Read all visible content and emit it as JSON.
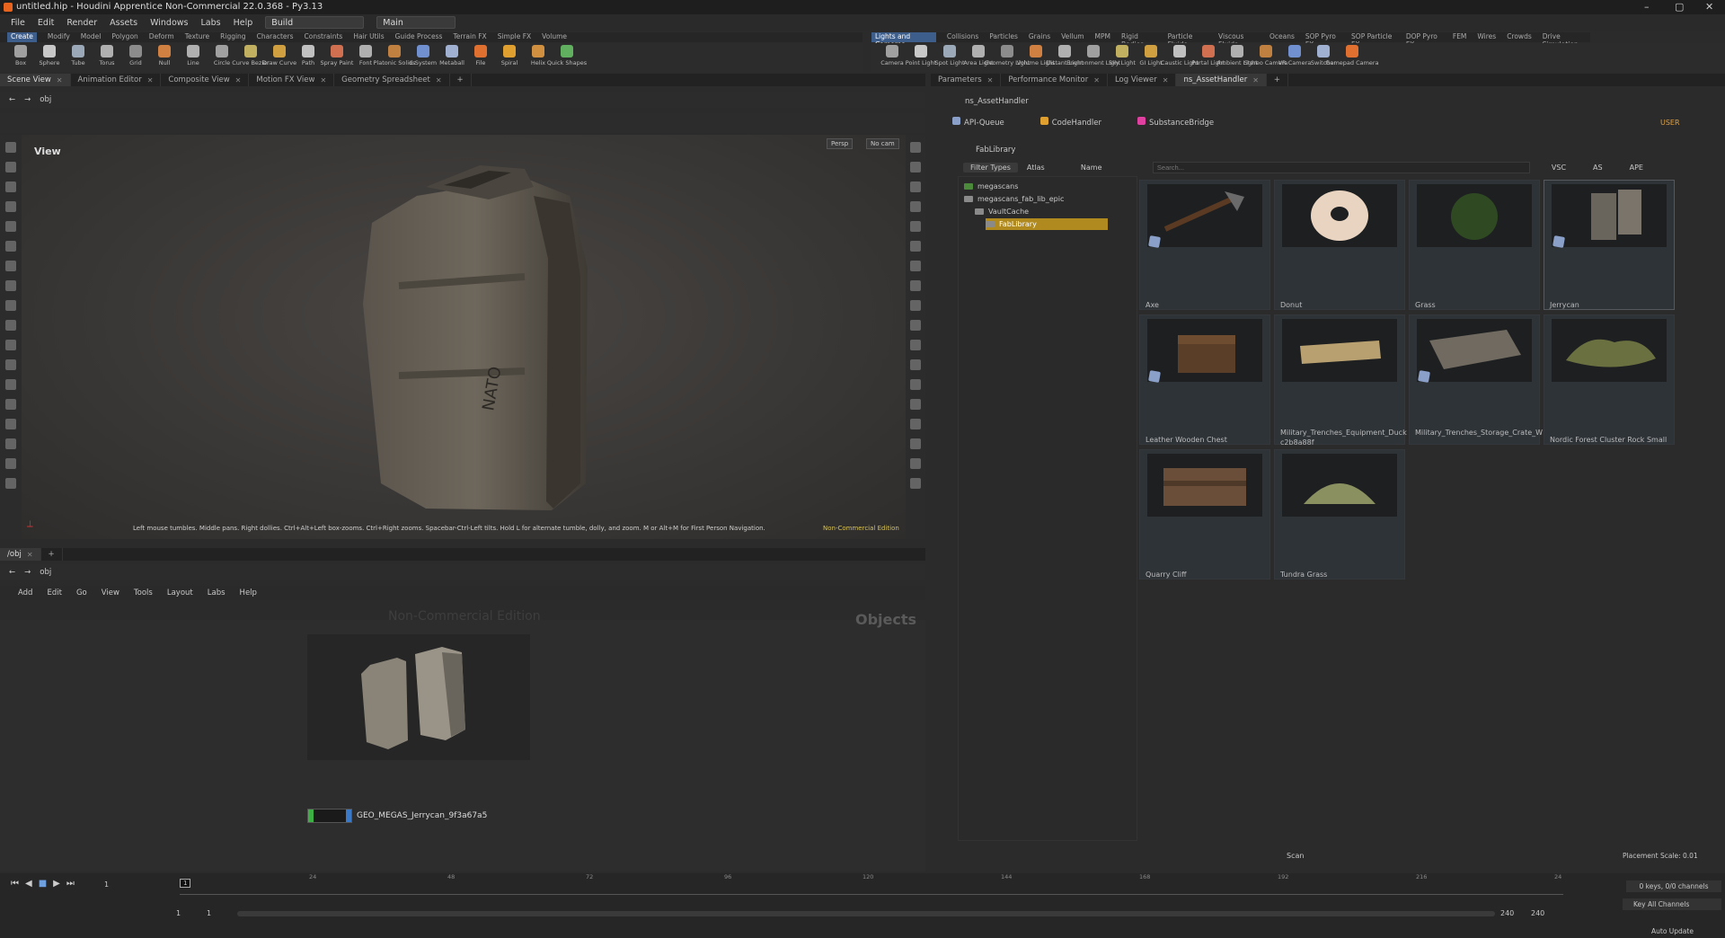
{
  "window": {
    "title": "untitled.hip - Houdini Apprentice Non-Commercial 22.0.368 - Py3.13"
  },
  "menu": {
    "items": [
      "File",
      "Edit",
      "Render",
      "Assets",
      "Windows",
      "Labs",
      "Help"
    ],
    "desktop": "Build",
    "context": "Main"
  },
  "shelf": {
    "tabs_left": [
      "Create",
      "Modify",
      "Model",
      "Polygon",
      "Deform",
      "Texture",
      "Rigging",
      "Characters",
      "Constraints",
      "Hair Utils",
      "Guide Process",
      "Terrain FX",
      "Simple FX",
      "Volume"
    ],
    "tabs_right": [
      "Lights and Cameras",
      "Collisions",
      "Particles",
      "Grains",
      "Vellum",
      "MPM",
      "Rigid Bodies",
      "Particle Fluids",
      "Viscous Fluids",
      "Oceans",
      "SOP Pyro FX",
      "SOP Particle FX",
      "DOP Pyro FX",
      "FEM",
      "Wires",
      "Crowds",
      "Drive Simulation"
    ],
    "tools_left": [
      "Box",
      "Sphere",
      "Tube",
      "Torus",
      "Grid",
      "Null",
      "Line",
      "Circle",
      "Curve Bezier",
      "Draw Curve",
      "Path",
      "Spray Paint",
      "Font",
      "Platonic Solids",
      "L-System",
      "Metaball",
      "File",
      "Spiral",
      "Helix",
      "Quick Shapes"
    ],
    "tools_right": [
      "Camera",
      "Point Light",
      "Spot Light",
      "Area Light",
      "Geometry Light",
      "Volume Light",
      "Distant Light",
      "Environment Light",
      "Sky Light",
      "GI Light",
      "Caustic Light",
      "Portal Light",
      "Ambient Light",
      "Stereo Camera",
      "VR Camera",
      "Switcher",
      "Gamepad Camera"
    ]
  },
  "left_tabs": [
    "Scene View",
    "Animation Editor",
    "Composite View",
    "Motion FX View",
    "Geometry Spreadsheet"
  ],
  "viewport": {
    "path": "obj",
    "label": "View",
    "persp": "Persp",
    "cam": "No cam",
    "hint": "Left mouse tumbles. Middle pans. Right dollies. Ctrl+Alt+Left box-zooms. Ctrl+Right zooms. Spacebar-Ctrl-Left tilts. Hold L for alternate tumble, dolly, and zoom. M or Alt+M for First Person Navigation.",
    "edition": "Non-Commercial Edition",
    "can_text": "NATO"
  },
  "network": {
    "tab": "/obj",
    "path": "obj",
    "menu": [
      "Add",
      "Edit",
      "Go",
      "View",
      "Tools",
      "Layout",
      "Labs",
      "Help"
    ],
    "watermark": "Non-Commercial Edition",
    "context_label": "Objects",
    "node_name": "GEO_MEGAS_Jerrycan_9f3a67a5"
  },
  "timeline": {
    "frame": "1",
    "ticks": [
      "24",
      "48",
      "72",
      "96",
      "120",
      "144",
      "168",
      "192",
      "216",
      "24"
    ],
    "start": "1",
    "start2": "1",
    "end": "240",
    "end2": "240",
    "keys": "0 keys, 0/0 channels",
    "key_all": "Key All Channels",
    "auto_update": "Auto Update"
  },
  "right_tabs": [
    "Parameters",
    "Performance Monitor",
    "Log Viewer",
    "ns_AssetHandler"
  ],
  "asset_handler": {
    "title": "ns_AssetHandler",
    "subtabs": [
      "API-Queue",
      "CodeHandler",
      "SubstanceBridge"
    ],
    "user": "USER",
    "library_label": "FabLibrary",
    "filter_types": "Filter Types",
    "atlas": "Atlas",
    "sort": "Name",
    "search_placeholder": "Search...",
    "toggles": [
      "VSC",
      "AS",
      "APE"
    ],
    "tree": [
      {
        "label": "megascans",
        "level": 0,
        "selected": false
      },
      {
        "label": "megascans_fab_lib_epic",
        "level": 0,
        "selected": false
      },
      {
        "label": "VaultCache",
        "level": 1,
        "selected": false
      },
      {
        "label": "FabLibrary",
        "level": 2,
        "selected": true
      }
    ],
    "assets": [
      {
        "name": "Axe",
        "badge": true
      },
      {
        "name": "Donut",
        "badge": false
      },
      {
        "name": "Grass",
        "badge": false
      },
      {
        "name": "Jerrycan",
        "badge": true
      },
      {
        "name": "Leather Wooden Chest",
        "badge": true
      },
      {
        "name": "Military_Trenches_Equipment_Duck c2b8a88f",
        "badge": false
      },
      {
        "name": "Military_Trenches_Storage_Crate_W",
        "badge": true
      },
      {
        "name": "Nordic Forest Cluster Rock Small",
        "badge": false
      },
      {
        "name": "Quarry Cliff",
        "badge": false
      },
      {
        "name": "Tundra Grass",
        "badge": false
      }
    ],
    "scan": "Scan",
    "placement_scale": "Placement Scale:  0.01"
  },
  "colors": {
    "accent": "#3d5d8a",
    "selection": "#b08a1e",
    "brand": "#e8641e"
  }
}
